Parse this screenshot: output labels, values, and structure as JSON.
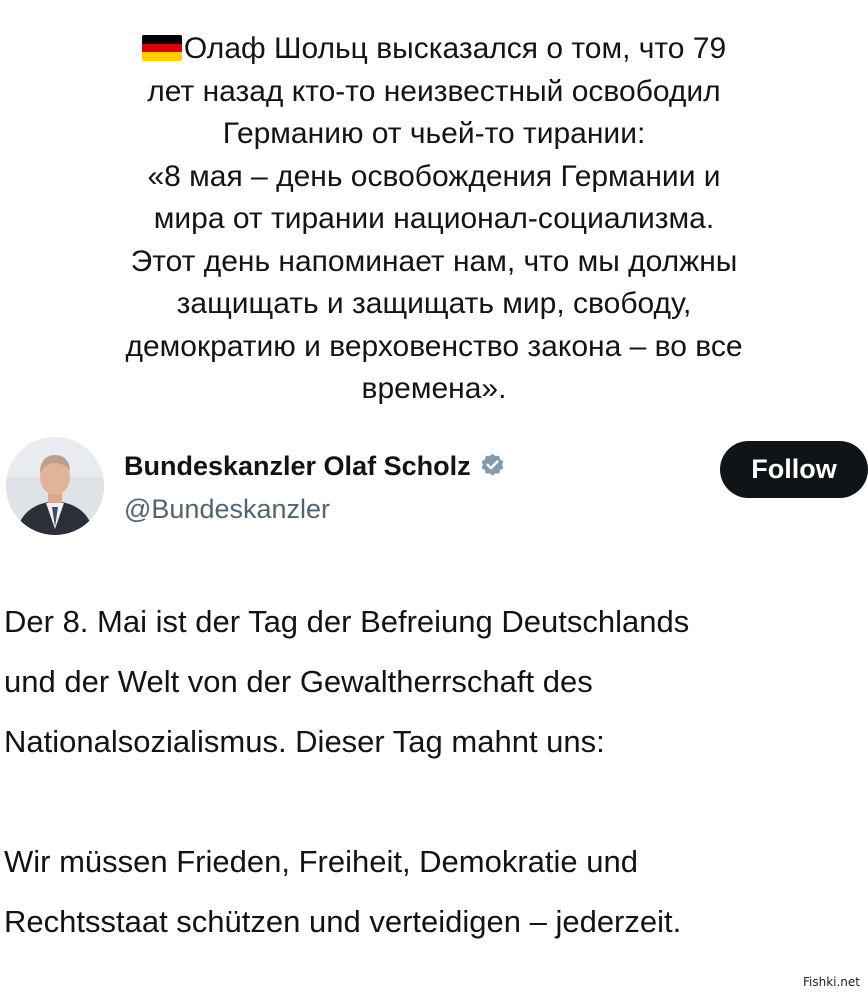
{
  "caption": {
    "lines": [
      "Олаф Шольц высказался о том, что 79",
      "лет назад кто-то неизвестный освободил",
      "Германию от чьей-то тирании:",
      "«8 мая – день освобождения Германии и",
      "мира от тирании национал-социализма.",
      "Этот день напоминает нам, что мы должны",
      "защищать и защищать мир, свободу,",
      "демократию и верховенство закона – во все",
      "времена»."
    ],
    "flag_colors": [
      "#000000",
      "#dd0000",
      "#ffce00"
    ]
  },
  "tweet": {
    "author_name": "Bundeskanzler Olaf Scholz",
    "handle": "@Bundeskanzler",
    "follow_label": "Follow",
    "verified_badge_color": "#829aab",
    "body_lines_1": [
      "Der 8. Mai ist der Tag der Befreiung Deutschlands",
      "und der Welt von der Gewaltherrschaft des",
      "Nationalsozialismus. Dieser Tag mahnt uns:"
    ],
    "body_lines_2": [
      "Wir müssen Frieden, Freiheit, Demokratie und",
      "Rechtsstaat schützen und verteidigen – jederzeit."
    ]
  },
  "watermark": "Fishki.net"
}
